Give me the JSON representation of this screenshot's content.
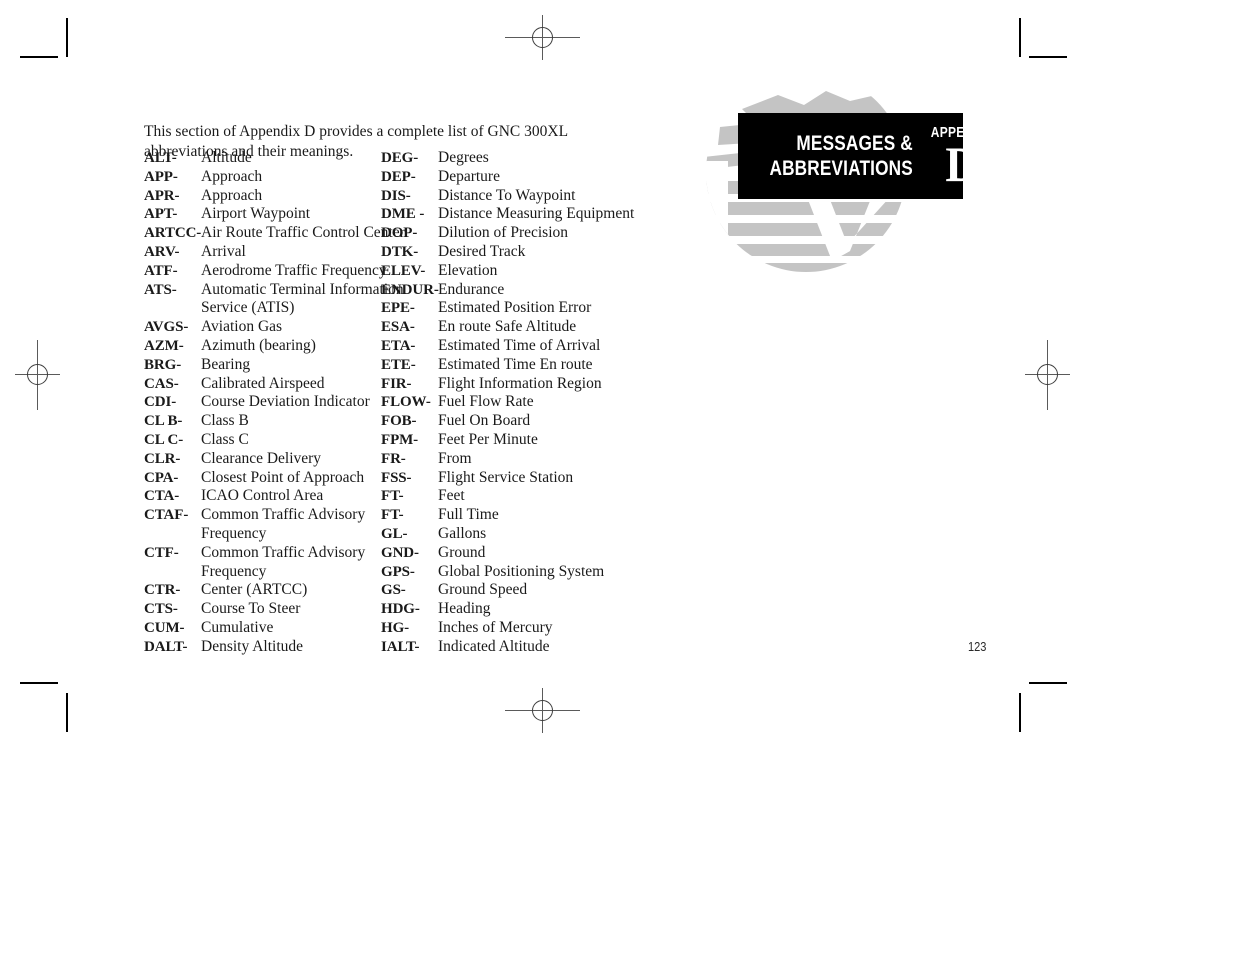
{
  "page": {
    "number": "123",
    "intro": "This section of Appendix D provides a complete list of GNC 300XL abbreviations and their meanings."
  },
  "header": {
    "title_line1": "MESSAGES &",
    "title_line2": "ABBREVIATIONS",
    "appendix_label": "APPENDIX",
    "appendix_letter": "D",
    "badge_bg": "#000000",
    "badge_text_color": "#ffffff",
    "globe_color": "#c4c4c4"
  },
  "abbreviations": {
    "left_column": [
      {
        "term": "ALT-",
        "definition": "Altitude"
      },
      {
        "term": "APP-",
        "definition": "Approach"
      },
      {
        "term": "APR-",
        "definition": "Approach"
      },
      {
        "term": "APT-",
        "definition": "Airport Waypoint"
      },
      {
        "term": "ARTCC-",
        "definition": "Air Route Traffic Control Center"
      },
      {
        "term": "ARV-",
        "definition": "Arrival"
      },
      {
        "term": "ATF-",
        "definition": "Aerodrome Traffic Frequency"
      },
      {
        "term": "ATS-",
        "definition": "Automatic Terminal Information"
      },
      {
        "term": "",
        "definition": "Service (ATIS)"
      },
      {
        "term": "AVGS-",
        "definition": "Aviation Gas"
      },
      {
        "term": "AZM-",
        "definition": "Azimuth (bearing)"
      },
      {
        "term": "BRG-",
        "definition": "Bearing"
      },
      {
        "term": "CAS-",
        "definition": "Calibrated Airspeed"
      },
      {
        "term": "CDI-",
        "definition": "Course Deviation Indicator"
      },
      {
        "term": "CL B-",
        "definition": "Class B"
      },
      {
        "term": "CL C-",
        "definition": "Class C"
      },
      {
        "term": "CLR-",
        "definition": "Clearance Delivery"
      },
      {
        "term": "CPA-",
        "definition": "Closest Point of Approach"
      },
      {
        "term": "CTA-",
        "definition": "ICAO Control Area"
      },
      {
        "term": "CTAF-",
        "definition": "Common Traffic Advisory"
      },
      {
        "term": "",
        "definition": "Frequency"
      },
      {
        "term": "CTF-",
        "definition": "Common Traffic Advisory"
      },
      {
        "term": "",
        "definition": "Frequency"
      },
      {
        "term": "CTR-",
        "definition": "Center (ARTCC)"
      },
      {
        "term": "CTS-",
        "definition": "Course To Steer"
      },
      {
        "term": "CUM-",
        "definition": "Cumulative"
      },
      {
        "term": "DALT-",
        "definition": "Density Altitude"
      }
    ],
    "right_column": [
      {
        "term": "DEG-",
        "definition": "Degrees"
      },
      {
        "term": "DEP-",
        "definition": "Departure"
      },
      {
        "term": "DIS-",
        "definition": "Distance To Waypoint"
      },
      {
        "term": "DME -",
        "definition": "Distance Measuring Equipment"
      },
      {
        "term": "DOP-",
        "definition": "Dilution of Precision"
      },
      {
        "term": "DTK-",
        "definition": "Desired Track"
      },
      {
        "term": "ELEV-",
        "definition": "Elevation"
      },
      {
        "term": "ENDUR-",
        "definition": "Endurance"
      },
      {
        "term": "EPE-",
        "definition": "Estimated Position Error"
      },
      {
        "term": "ESA-",
        "definition": "En route Safe Altitude"
      },
      {
        "term": "ETA-",
        "definition": "Estimated Time of Arrival"
      },
      {
        "term": "ETE-",
        "definition": "Estimated Time En route"
      },
      {
        "term": "FIR-",
        "definition": "Flight Information Region"
      },
      {
        "term": "FLOW-",
        "definition": "Fuel Flow Rate"
      },
      {
        "term": "FOB-",
        "definition": "Fuel On Board"
      },
      {
        "term": "FPM-",
        "definition": "Feet Per Minute"
      },
      {
        "term": "FR-",
        "definition": "From"
      },
      {
        "term": "FSS-",
        "definition": "Flight Service Station"
      },
      {
        "term": "FT-",
        "definition": "Feet"
      },
      {
        "term": "FT-",
        "definition": "Full Time"
      },
      {
        "term": "GL-",
        "definition": "Gallons"
      },
      {
        "term": "GND-",
        "definition": "Ground"
      },
      {
        "term": "GPS-",
        "definition": "Global Positioning System"
      },
      {
        "term": "GS-",
        "definition": "Ground Speed"
      },
      {
        "term": "HDG-",
        "definition": "Heading"
      },
      {
        "term": "HG-",
        "definition": "Inches of Mercury"
      },
      {
        "term": "IALT-",
        "definition": "Indicated Altitude"
      }
    ]
  }
}
